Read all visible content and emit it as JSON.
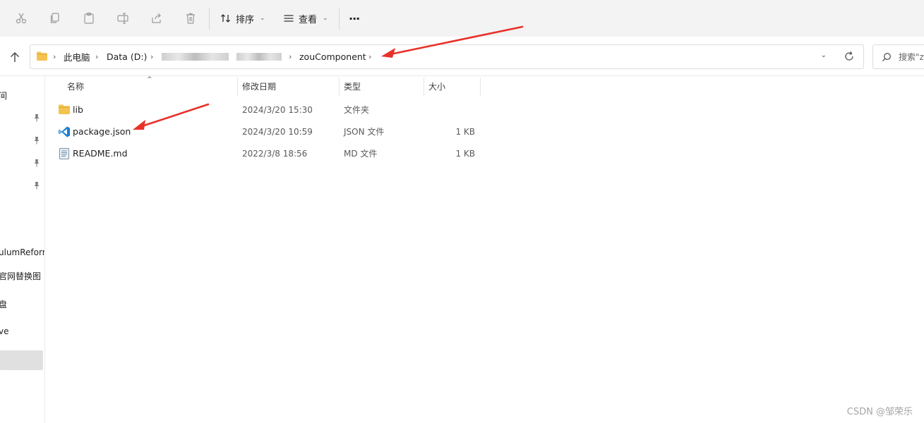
{
  "toolbar": {
    "sort_label": "排序",
    "view_label": "查看",
    "more_label": "···"
  },
  "address": {
    "crumbs": [
      "此电脑",
      "Data (D:)",
      "zouComponent"
    ]
  },
  "search": {
    "placeholder": "搜索\"z"
  },
  "sidebar": {
    "items": [
      "间",
      "ulumReform",
      "官网替换图",
      "盘",
      "ve"
    ]
  },
  "columns": {
    "name": "名称",
    "modified": "修改日期",
    "type": "类型",
    "size": "大小"
  },
  "files": [
    {
      "name": "lib",
      "modified": "2024/3/20 15:30",
      "type": "文件夹",
      "size": "",
      "icon": "folder-icon"
    },
    {
      "name": "package.json",
      "modified": "2024/3/20 10:59",
      "type": "JSON 文件",
      "size": "1 KB",
      "icon": "vscode-icon"
    },
    {
      "name": "README.md",
      "modified": "2022/3/8 18:56",
      "type": "MD 文件",
      "size": "1 KB",
      "icon": "text-file-icon"
    }
  ],
  "watermark": "CSDN @邹荣乐",
  "colors": {
    "annotation_arrow": "#e8312a",
    "folder": "#f4c24f",
    "vscode": "#1b7fd1"
  }
}
